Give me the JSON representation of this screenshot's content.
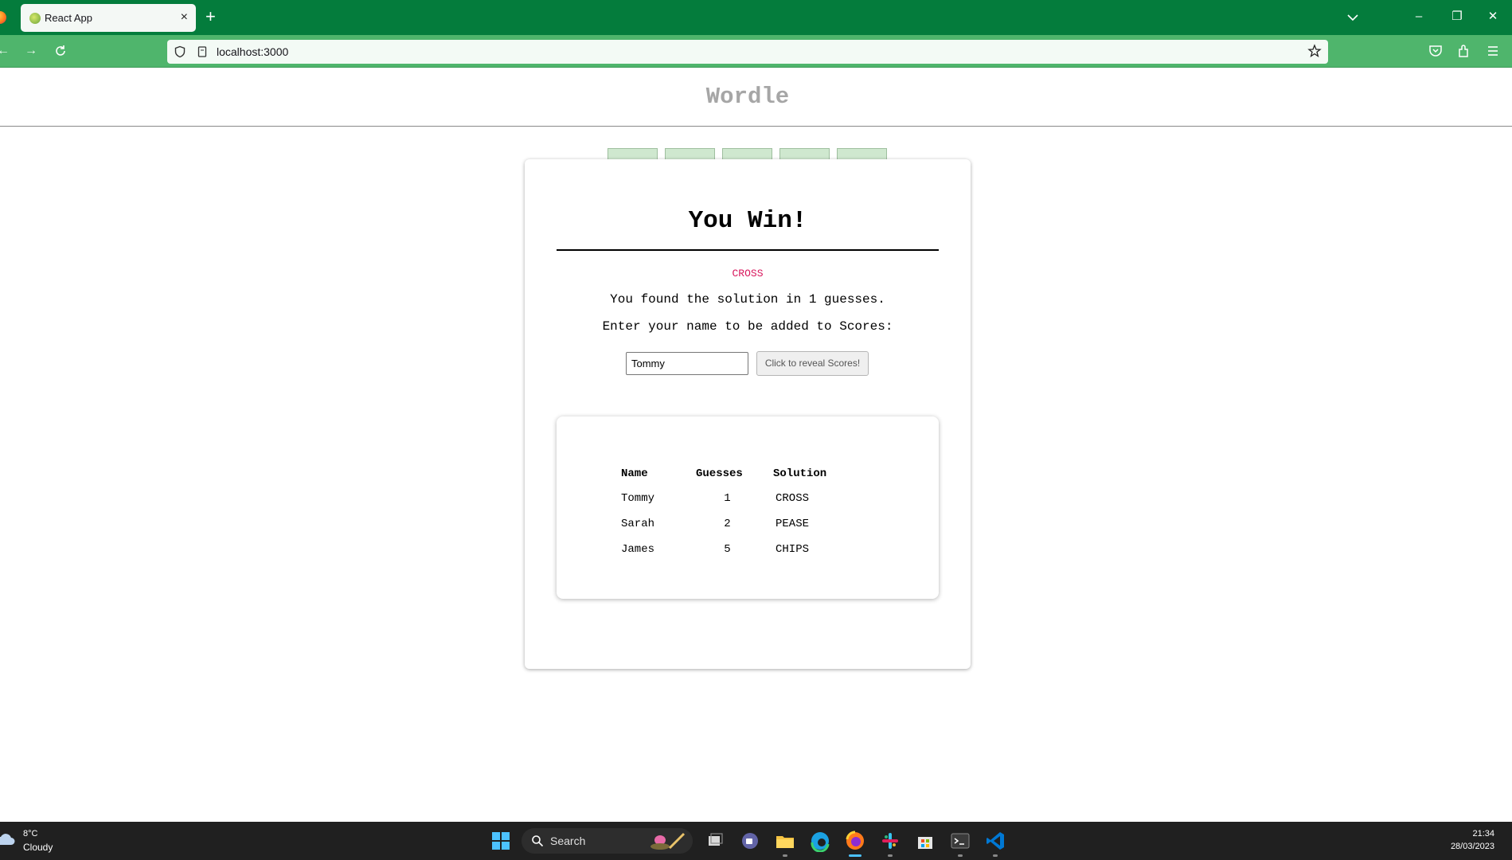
{
  "browser": {
    "tab_title": "React App",
    "tab_close": "×",
    "new_tab": "+",
    "url": "localhost:3000",
    "window_controls": {
      "minimize": "–",
      "restore": "❐",
      "close": "✕"
    },
    "nav": {
      "back": "←",
      "forward": "→"
    }
  },
  "app": {
    "title": "Wordle",
    "tile_color": "#cfe8cf"
  },
  "modal": {
    "title": "You Win!",
    "solution": "CROSS",
    "found_message": "You found the solution in 1 guesses.",
    "prompt": "Enter your name to be added to Scores:",
    "name_value": "Tommy",
    "reveal_button": "Click to reveal Scores!",
    "solution_color": "#d8165c"
  },
  "scores": {
    "headers": [
      "Name",
      "Guesses",
      "Solution"
    ],
    "rows": [
      [
        "Tommy",
        "1",
        "CROSS"
      ],
      [
        "Sarah",
        "2",
        "PEASE"
      ],
      [
        "James",
        "5",
        "CHIPS"
      ]
    ]
  },
  "taskbar": {
    "weather_temp": "8°C",
    "weather_condition": "Cloudy",
    "search_label": "Search",
    "clock_time": "21:34",
    "clock_date": "28/03/2023",
    "pinned_icons": [
      "windows-start-icon",
      "search-icon",
      "task-view-icon",
      "teams-chat-icon",
      "file-explorer-icon",
      "edge-icon",
      "firefox-icon",
      "slack-icon",
      "microsoft-store-icon",
      "terminal-icon",
      "vscode-icon"
    ]
  },
  "theme": {
    "tabbar_color": "#047c3c",
    "navbar_color": "#4fb56c"
  }
}
